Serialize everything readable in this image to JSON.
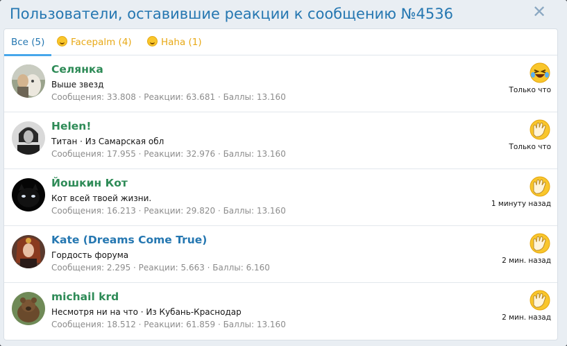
{
  "overlay": {
    "title": "Пользователи, оставившие реакции к сообщению №4536",
    "close_icon": "close-icon"
  },
  "tabs": [
    {
      "label": "Все (5)",
      "active": true
    },
    {
      "label": "Facepalm (4)",
      "icon": "facepalm-emoji-icon",
      "active": false
    },
    {
      "label": "Haha (1)",
      "icon": "haha-emoji-icon",
      "active": false
    }
  ],
  "colors": {
    "accent": "#2577b1",
    "tab_underline": "#47a7eb",
    "reaction_label": "#e8a917",
    "username_green": "#2e8b57",
    "username_blue": "#2577b1",
    "stats_gray": "#8c8c8c"
  },
  "users": [
    {
      "name": "Селянка",
      "name_color": "#2e8b57",
      "title": "Выше звезд",
      "stats": "Сообщения: 33.808 · Реакции: 63.681 · Баллы: 13.160",
      "reaction_icon": "haha-emoji-icon",
      "time": "Только что"
    },
    {
      "name": "Helen!",
      "name_color": "#2e8b57",
      "title": "Титан · Из Самарская обл",
      "stats": "Сообщения: 17.955 · Реакции: 32.976 · Баллы: 13.160",
      "reaction_icon": "facepalm-emoji-icon",
      "time": "Только что"
    },
    {
      "name": "Йошкин Кот",
      "name_color": "#2e8b57",
      "title": "Кот всей твоей жизни.",
      "stats": "Сообщения: 16.213 · Реакции: 29.820 · Баллы: 13.160",
      "reaction_icon": "facepalm-emoji-icon",
      "time": "1 минуту назад"
    },
    {
      "name": "Kate (Dreams Come True)",
      "name_color": "#2577b1",
      "title": "Гордость форума",
      "stats": "Сообщения: 2.295 · Реакции: 5.663 · Баллы: 6.160",
      "reaction_icon": "facepalm-emoji-icon",
      "time": "2 мин. назад"
    },
    {
      "name": "michail krd",
      "name_color": "#2e8b57",
      "title": "Несмотря ни на что · Из Кубань-Краснодар",
      "stats": "Сообщения: 18.512 · Реакции: 61.859 · Баллы: 13.160",
      "reaction_icon": "facepalm-emoji-icon",
      "time": "2 мин. назад"
    }
  ]
}
